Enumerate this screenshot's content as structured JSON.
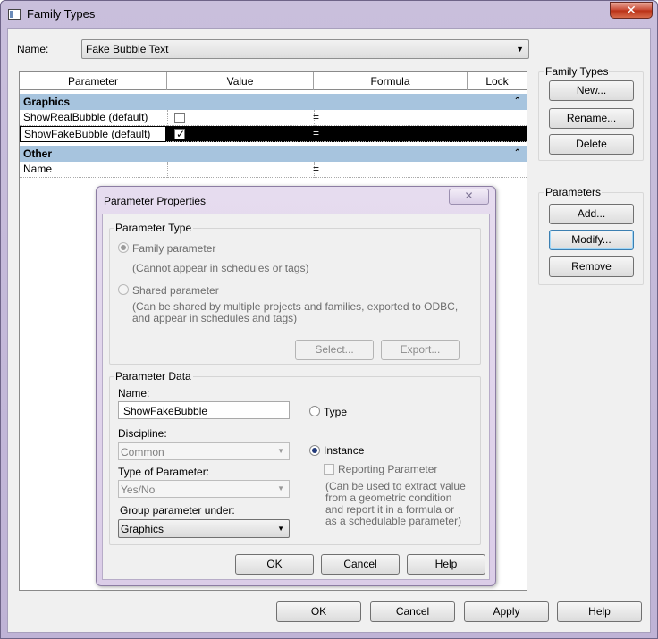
{
  "window": {
    "title": "Family Types"
  },
  "name_label": "Name:",
  "name_value": "Fake Bubble Text",
  "grid": {
    "columns": [
      "Parameter",
      "Value",
      "Formula",
      "Lock"
    ],
    "groups": [
      {
        "label": "Graphics",
        "rows": [
          {
            "param": "ShowRealBubble (default)",
            "checked": false,
            "formula": "="
          },
          {
            "param": "ShowFakeBubble (default)",
            "checked": true,
            "formula": "="
          }
        ]
      },
      {
        "label": "Other",
        "rows": [
          {
            "param": "Name",
            "formula": "="
          }
        ]
      }
    ]
  },
  "sidebar": {
    "family_types_title": "Family Types",
    "new": "New...",
    "rename": "Rename...",
    "delete": "Delete",
    "parameters_title": "Parameters",
    "add": "Add...",
    "modify": "Modify...",
    "remove": "Remove"
  },
  "footer": {
    "ok": "OK",
    "cancel": "Cancel",
    "apply": "Apply",
    "help": "Help"
  },
  "dialog": {
    "title": "Parameter Properties",
    "param_type_title": "Parameter Type",
    "family_param": "Family parameter",
    "family_param_note": "(Cannot appear in schedules or tags)",
    "shared_param": "Shared parameter",
    "shared_param_note": "(Can be shared by multiple projects and families, exported to ODBC, and appear in schedules and tags)",
    "select_btn": "Select...",
    "export_btn": "Export...",
    "param_data_title": "Parameter Data",
    "name_label": "Name:",
    "name_value": "ShowFakeBubble",
    "type_label": "Type",
    "instance_label": "Instance",
    "reporting_label": "Reporting Parameter",
    "reporting_note": "(Can be used to extract value from a geometric condition and report it in a formula or as a schedulable parameter)",
    "discipline_label": "Discipline:",
    "discipline_value": "Common",
    "type_of_param_label": "Type of Parameter:",
    "type_of_param_value": "Yes/No",
    "group_under_label": "Group parameter under:",
    "group_under_value": "Graphics",
    "ok": "OK",
    "cancel": "Cancel",
    "help": "Help"
  }
}
